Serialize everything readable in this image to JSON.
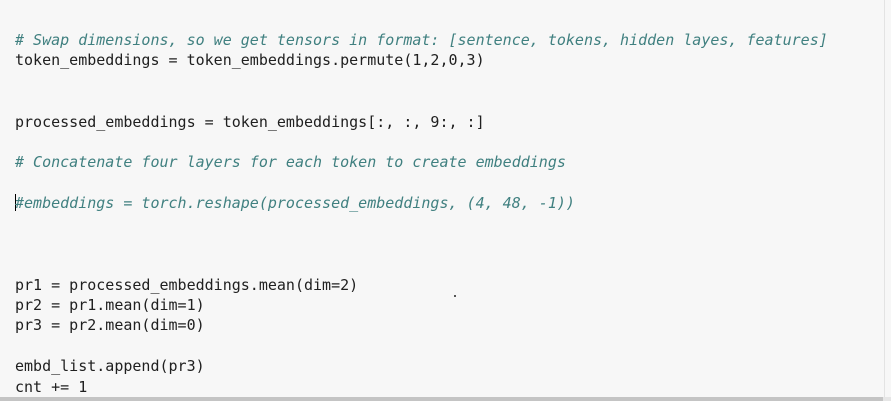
{
  "editor": {
    "lines": [
      "",
      "# Swap dimensions, so we get tensors in format: [sentence, tokens, hidden layes, features]",
      "token_embeddings = token_embeddings.permute(1,2,0,3)",
      "",
      "",
      "processed_embeddings = token_embeddings[:, :, 9:, :]",
      "",
      "# Concatenate four layers for each token to create embeddings",
      "",
      "#embeddings = torch.reshape(processed_embeddings, (4, 48, -1))",
      "",
      "",
      "",
      "pr1 = processed_embeddings.mean(dim=2)",
      "pr2 = pr1.mean(dim=1)",
      "pr3 = pr2.mean(dim=0)",
      "",
      "embd_list.append(pr3)",
      "cnt += 1"
    ]
  },
  "colors": {
    "background": "#f7f7f7",
    "comment": "#408080",
    "code": "#202020",
    "number": "#008800"
  }
}
